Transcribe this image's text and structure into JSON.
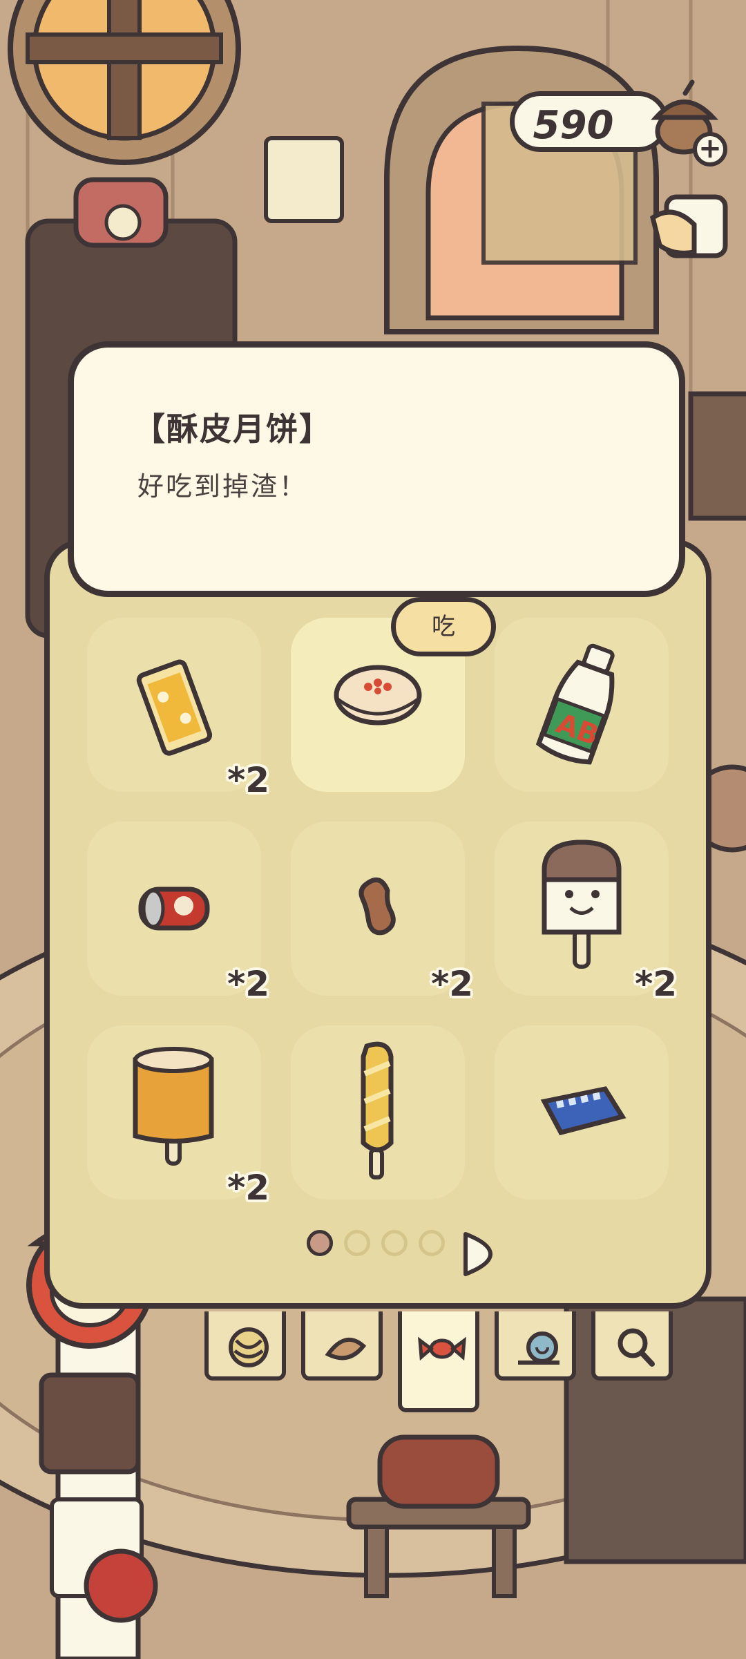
{
  "currency": {
    "amount": "590",
    "icon": "acorn-icon",
    "add_icon": "plus-icon"
  },
  "detail": {
    "title": "【酥皮月饼】",
    "description": "好吃到掉渣！"
  },
  "action": {
    "eat_label": "吃"
  },
  "inventory": {
    "items": [
      {
        "name": "snack-bar",
        "qty": "*2",
        "selected": false
      },
      {
        "name": "mooncake",
        "qty": "",
        "selected": true
      },
      {
        "name": "ab-milk-bottle",
        "qty": "",
        "selected": false
      },
      {
        "name": "soda-can",
        "qty": "*2",
        "selected": false
      },
      {
        "name": "peanut",
        "qty": "*2",
        "selected": false
      },
      {
        "name": "smiley-popsicle",
        "qty": "*2",
        "selected": false
      },
      {
        "name": "caramel-popsicle",
        "qty": "*2",
        "selected": false
      },
      {
        "name": "twisted-bread-stick",
        "qty": "",
        "selected": false
      },
      {
        "name": "blue-wrapped-candy",
        "qty": "",
        "selected": false
      }
    ]
  },
  "pagination": {
    "pages": 4,
    "current": 1,
    "next_icon": "chevron-right-icon"
  },
  "tabs": [
    {
      "icon": "yarn-icon",
      "active": false
    },
    {
      "icon": "leaf-icon",
      "active": false
    },
    {
      "icon": "candy-icon",
      "active": true
    },
    {
      "icon": "snail-icon",
      "active": false
    },
    {
      "icon": "magnifier-icon",
      "active": false
    }
  ]
}
